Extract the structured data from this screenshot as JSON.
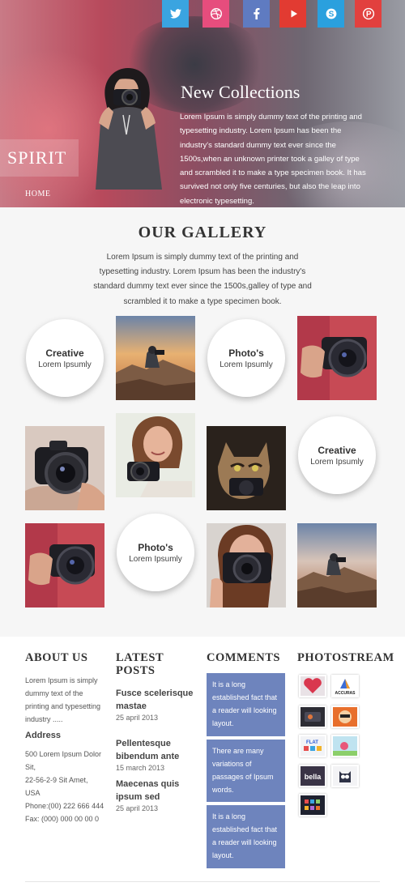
{
  "social": [
    {
      "name": "twitter",
      "color": "#3aa4e0"
    },
    {
      "name": "dribbble",
      "color": "#e64d7d"
    },
    {
      "name": "facebook",
      "color": "#5f7bc1"
    },
    {
      "name": "youtube",
      "color": "#e23b32"
    },
    {
      "name": "skype",
      "color": "#2aa0de"
    },
    {
      "name": "pinterest",
      "color": "#e2403e"
    }
  ],
  "brand": "SPIRIT",
  "nav": {
    "home": "HOME"
  },
  "hero": {
    "title": "New Collections",
    "text": "Lorem Ipsum is simply dummy text of the printing and typesetting industry. Lorem Ipsum has been the industry's standard dummy text ever since the 1500s,when an unknown printer took a galley of type and scrambled it to make a type specimen book. It has survived not only five centuries, but also the leap into electronic typesetting."
  },
  "gallery": {
    "title": "OUR GALLERY",
    "text": "Lorem Ipsum is simply dummy text of the printing and typesetting industry. Lorem Ipsum has been the industry's standard dummy text ever since the 1500s,galley of type and scrambled it to make a type specimen book.",
    "circles": [
      {
        "title": "Creative",
        "sub": "Lorem Ipsumly"
      },
      {
        "title": "Photo's",
        "sub": "Lorem Ipsumly"
      },
      {
        "title": "Creative",
        "sub": "Lorem Ipsumly"
      },
      {
        "title": "Photo's",
        "sub": "Lorem Ipsumly"
      }
    ]
  },
  "about": {
    "heading": "ABOUT US",
    "text": "Lorem Ipsum is simply dummy text of the printing and typesetting industry .....",
    "address_heading": "Address",
    "address": [
      "500 Lorem Ipsum Dolor Sit,",
      "22-56-2-9 Sit Amet,",
      "USA",
      "Phone:(00) 222 666 444",
      "Fax: (000) 000 00 00 0"
    ]
  },
  "posts": {
    "heading": "LATEST POSTS",
    "items": [
      {
        "title": "Fusce scelerisque mastae",
        "date": "25 april 2013"
      },
      {
        "title": "Pellentesque bibendum ante",
        "date": "15 march 2013"
      },
      {
        "title": "Maecenas quis ipsum sed",
        "date": "25 april 2013"
      }
    ]
  },
  "comments": {
    "heading": "COMMENTS",
    "items": [
      "It is a long established fact that a reader will looking layout.",
      "There are many variations of passages of Ipsum words.",
      "It is a long established fact that a reader will looking layout."
    ]
  },
  "photostream": {
    "heading": "PHOTOSTREAM",
    "thumbs": [
      {
        "label": ""
      },
      {
        "label": "ACCURAS"
      },
      {
        "label": ""
      },
      {
        "label": ""
      },
      {
        "label": "FLAT"
      },
      {
        "label": ""
      },
      {
        "label": "bella"
      },
      {
        "label": ""
      },
      {
        "label": ""
      }
    ]
  }
}
